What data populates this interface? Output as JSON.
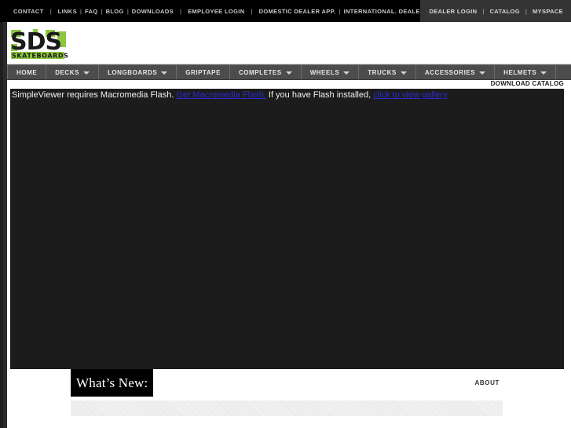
{
  "topbar": {
    "left_links": [
      "CONTACT",
      "LINKS",
      "FAQ",
      "BLOG",
      "DOWNLOADS",
      "EMPLOYEE LOGIN",
      "DOMESTIC DEALER APP.",
      "INTERNATIONAL. DEALER APP."
    ],
    "separator": "|",
    "right_links": [
      "DEALER LOGIN",
      "CATALOG",
      "MYSPACE"
    ]
  },
  "logo": {
    "mark": "SDS",
    "wordmark": "SKATEBOARDS",
    "accent_color": "#8DC63F",
    "text_color": "#1a1a1a"
  },
  "mainnav": {
    "items": [
      {
        "label": "HOME",
        "has_dropdown": false
      },
      {
        "label": "DECKS",
        "has_dropdown": true
      },
      {
        "label": "LONGBOARDS",
        "has_dropdown": true
      },
      {
        "label": "GRIPTAPE",
        "has_dropdown": false
      },
      {
        "label": "COMPLETES",
        "has_dropdown": true
      },
      {
        "label": "WHEELS",
        "has_dropdown": true
      },
      {
        "label": "TRUCKS",
        "has_dropdown": true
      },
      {
        "label": "ACCESSORIES",
        "has_dropdown": true
      },
      {
        "label": "HELMETS",
        "has_dropdown": true
      }
    ],
    "background": "#4c4c4c"
  },
  "catalog": {
    "label": "DOWNLOAD CATALOG"
  },
  "gallery": {
    "message_part1": "SimpleViewer requires Macromedia Flash.",
    "link1": "Get Macromedia Flash.",
    "message_part2": "If you have Flash installed,",
    "link2": "click to view gallery",
    "background": "#1c1c1c",
    "link_color": "#2b2bd4"
  },
  "whats_new": {
    "label": "What’s New:"
  },
  "about": {
    "label": "ABOUT"
  }
}
